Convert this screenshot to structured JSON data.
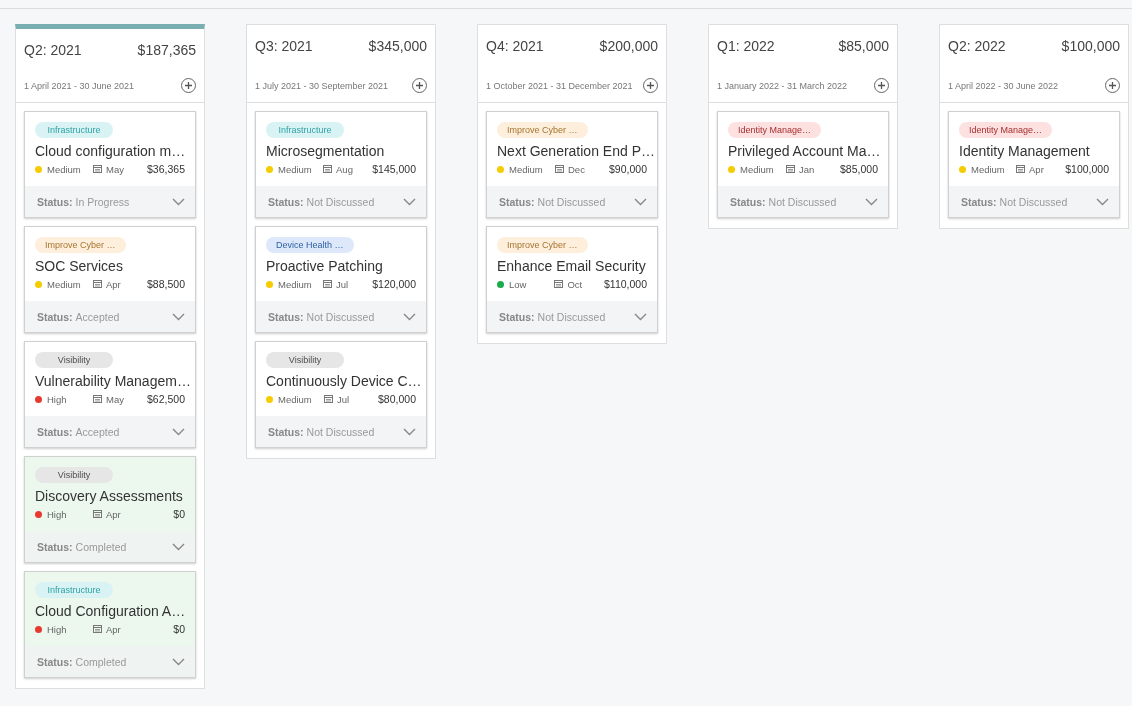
{
  "columns": [
    {
      "quarter": "Q2: 2021",
      "total": "$187,365",
      "dates": "1 April 2021 - 30 June 2021",
      "selected": true,
      "cards": [
        {
          "tag": {
            "label": "Infrastructure",
            "color": "#d9f3f4"
          },
          "title": "Cloud configuration m…",
          "priority": {
            "label": "Medium",
            "color": "#f5cc00"
          },
          "month": "May",
          "amount": "$36,365",
          "status_label": "Status:",
          "status": "In Progress",
          "done": false
        },
        {
          "tag": {
            "label": "Improve Cyber …",
            "color": "#fdefdc"
          },
          "title": "SOC Services",
          "priority": {
            "label": "Medium",
            "color": "#f5cc00"
          },
          "month": "Apr",
          "amount": "$88,500",
          "status_label": "Status:",
          "status": "Accepted",
          "done": false
        },
        {
          "tag": {
            "label": "Visibility",
            "color": "#e6e6e6"
          },
          "title": "Vulnerability Managem…",
          "priority": {
            "label": "High",
            "color": "#e8392f"
          },
          "month": "May",
          "amount": "$62,500",
          "status_label": "Status:",
          "status": "Accepted",
          "done": false
        },
        {
          "tag": {
            "label": "Visibility",
            "color": "#e6e6e6"
          },
          "title": "Discovery Assessments",
          "priority": {
            "label": "High",
            "color": "#e8392f"
          },
          "month": "Apr",
          "amount": "$0",
          "status_label": "Status:",
          "status": "Completed",
          "done": true
        },
        {
          "tag": {
            "label": "Infrastructure",
            "color": "#d9f3f4"
          },
          "title": "Cloud Configuration A…",
          "priority": {
            "label": "High",
            "color": "#e8392f"
          },
          "month": "Apr",
          "amount": "$0",
          "status_label": "Status:",
          "status": "Completed",
          "done": true
        }
      ]
    },
    {
      "quarter": "Q3: 2021",
      "total": "$345,000",
      "dates": "1 July 2021 - 30 September 2021",
      "selected": false,
      "cards": [
        {
          "tag": {
            "label": "Infrastructure",
            "color": "#d9f3f4"
          },
          "title": "Microsegmentation",
          "priority": {
            "label": "Medium",
            "color": "#f5cc00"
          },
          "month": "Aug",
          "amount": "$145,000",
          "status_label": "Status:",
          "status": "Not Discussed",
          "done": false
        },
        {
          "tag": {
            "label": "Device Health …",
            "color": "#dde9fa"
          },
          "title": "Proactive Patching",
          "priority": {
            "label": "Medium",
            "color": "#f5cc00"
          },
          "month": "Jul",
          "amount": "$120,000",
          "status_label": "Status:",
          "status": "Not Discussed",
          "done": false
        },
        {
          "tag": {
            "label": "Visibility",
            "color": "#e6e6e6"
          },
          "title": "Continuously Device C…",
          "priority": {
            "label": "Medium",
            "color": "#f5cc00"
          },
          "month": "Jul",
          "amount": "$80,000",
          "status_label": "Status:",
          "status": "Not Discussed",
          "done": false
        }
      ]
    },
    {
      "quarter": "Q4: 2021",
      "total": "$200,000",
      "dates": "1 October 2021 - 31 December 2021",
      "selected": false,
      "cards": [
        {
          "tag": {
            "label": "Improve Cyber …",
            "color": "#fdefdc"
          },
          "title": "Next Generation End P…",
          "priority": {
            "label": "Medium",
            "color": "#f5cc00"
          },
          "month": "Dec",
          "amount": "$90,000",
          "status_label": "Status:",
          "status": "Not Discussed",
          "done": false
        },
        {
          "tag": {
            "label": "Improve Cyber …",
            "color": "#fdefdc"
          },
          "title": "Enhance Email Security",
          "priority": {
            "label": "Low",
            "color": "#1aab4b"
          },
          "month": "Oct",
          "amount": "$110,000",
          "status_label": "Status:",
          "status": "Not Discussed",
          "done": false
        }
      ]
    },
    {
      "quarter": "Q1: 2022",
      "total": "$85,000",
      "dates": "1 January 2022 - 31 March 2022",
      "selected": false,
      "cards": [
        {
          "tag": {
            "label": "Identity Manage…",
            "color": "#fde0e0"
          },
          "title": "Privileged Account Ma…",
          "priority": {
            "label": "Medium",
            "color": "#f5cc00"
          },
          "month": "Jan",
          "amount": "$85,000",
          "status_label": "Status:",
          "status": "Not Discussed",
          "done": false
        }
      ]
    },
    {
      "quarter": "Q2: 2022",
      "total": "$100,000",
      "dates": "1 April 2022 - 30 June 2022",
      "selected": false,
      "cards": [
        {
          "tag": {
            "label": "Identity Manage…",
            "color": "#fde0e0"
          },
          "title": "Identity Management",
          "priority": {
            "label": "Medium",
            "color": "#f5cc00"
          },
          "month": "Apr",
          "amount": "$100,000",
          "status_label": "Status:",
          "status": "Not Discussed",
          "done": false
        }
      ]
    }
  ]
}
